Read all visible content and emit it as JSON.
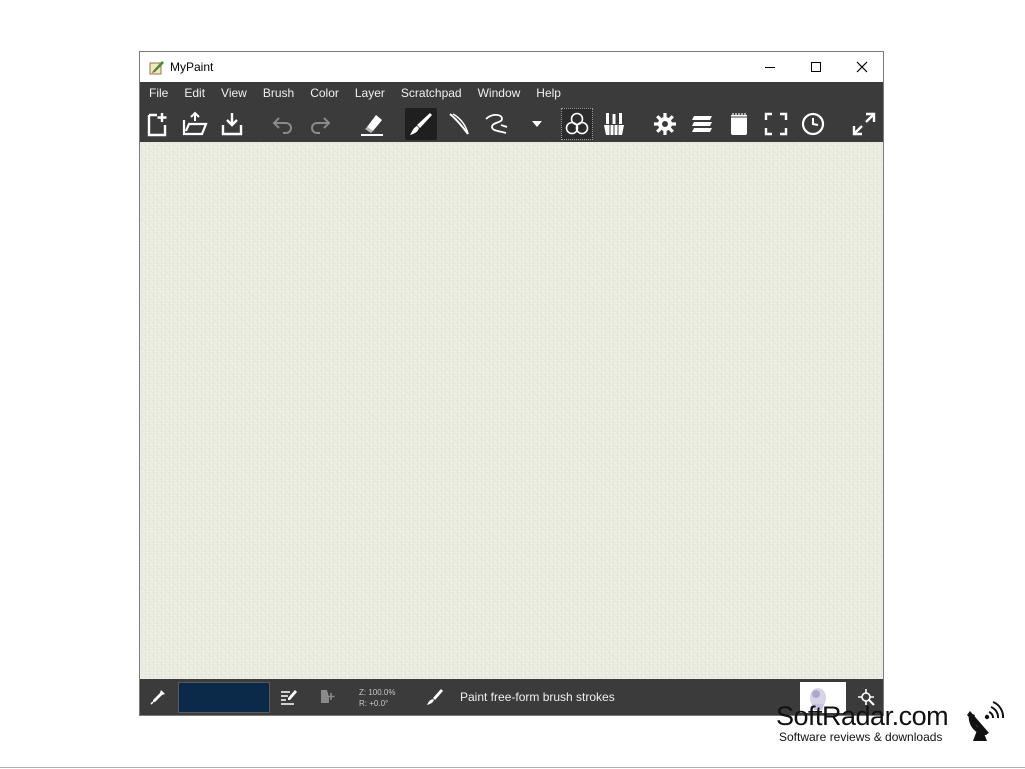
{
  "window": {
    "title": "MyPaint"
  },
  "menu": [
    "File",
    "Edit",
    "View",
    "Brush",
    "Color",
    "Layer",
    "Scratchpad",
    "Window",
    "Help"
  ],
  "status": {
    "zoom": "Z: 100.0%",
    "rotation": "R: +0.0°",
    "message": "Paint free-form brush strokes"
  },
  "colors": {
    "chrome": "#3b3b3b",
    "canvas": "#ecede1",
    "current_color": "#0b2a4a"
  },
  "watermark": {
    "name": "SoftRadar.com",
    "tagline": "Software reviews & downloads"
  },
  "icons": {
    "app": "mypaint-app-icon",
    "toolbar": [
      "new-document-icon",
      "open-file-icon",
      "save-icon",
      "undo-icon",
      "redo-icon",
      "eraser-icon",
      "brush-icon",
      "inking-icon",
      "connected-lines-icon",
      "dropdown-icon",
      "color-wheel-icon",
      "brushes-icon",
      "settings-icon",
      "layers-icon",
      "scratchpad-icon",
      "fullscreen-icon",
      "history-icon",
      "expand-icon"
    ]
  }
}
